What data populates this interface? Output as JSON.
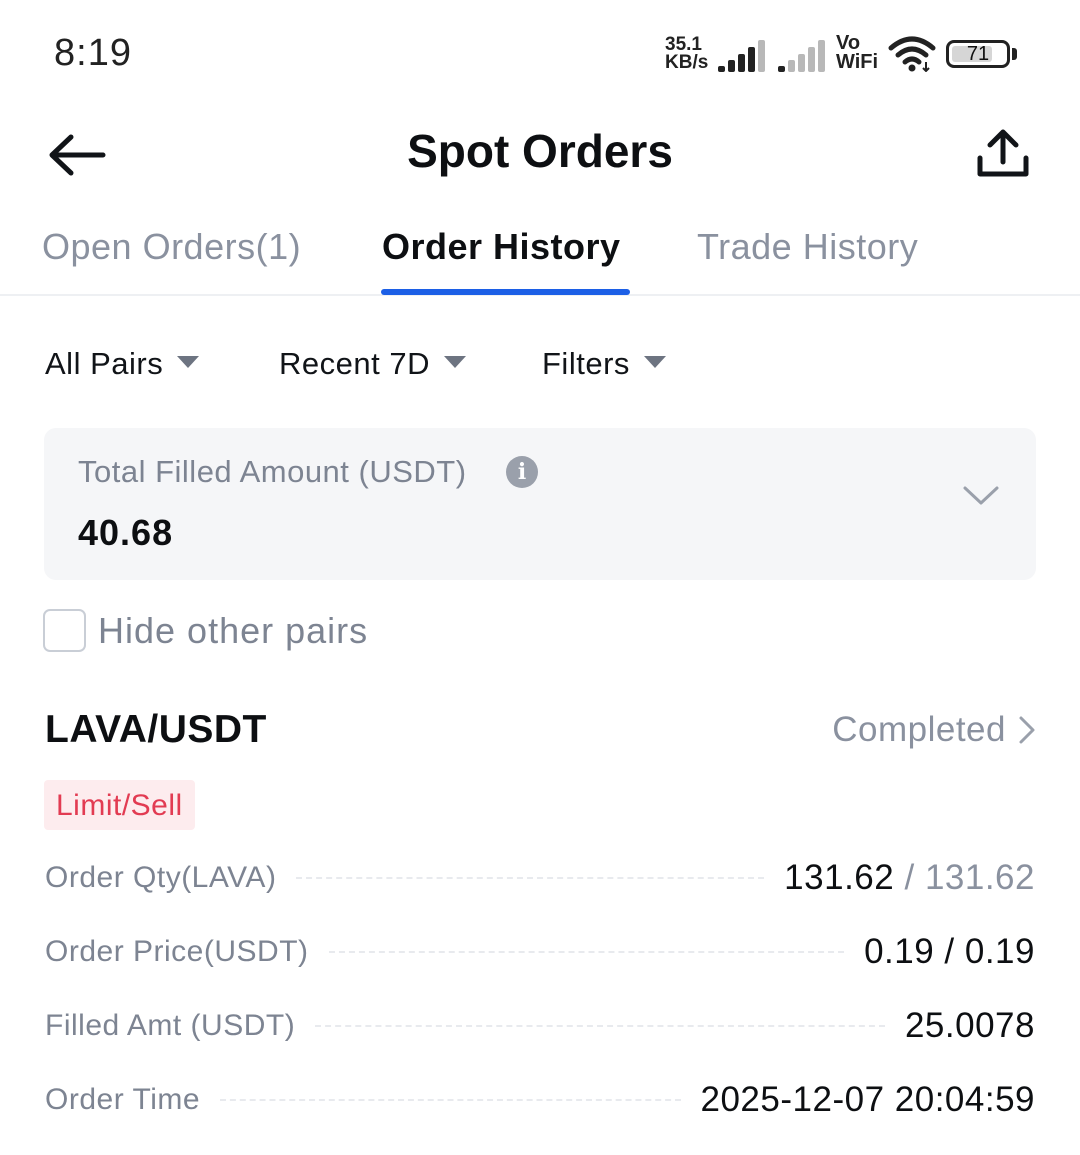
{
  "status_bar": {
    "time": "8:19",
    "net_speed_value": "35.1",
    "net_speed_unit": "KB/s",
    "vo_label": "Vo",
    "wifi_label": "WiFi",
    "battery_level": "71"
  },
  "header": {
    "title": "Spot Orders"
  },
  "tabs": [
    {
      "label": "Open Orders(1)",
      "active": false
    },
    {
      "label": "Order History",
      "active": true
    },
    {
      "label": "Trade History",
      "active": false
    }
  ],
  "filters": {
    "pairs": "All Pairs",
    "period": "Recent 7D",
    "filters": "Filters"
  },
  "summary": {
    "label": "Total Filled Amount (USDT)",
    "value": "40.68"
  },
  "hide_pairs": {
    "label": "Hide other pairs",
    "checked": false
  },
  "order": {
    "pair": "LAVA/USDT",
    "status": "Completed",
    "type": "Limit/Sell",
    "qty": {
      "label": "Order Qty(LAVA)",
      "filled": "131.62",
      "separator": "/",
      "total": "131.62"
    },
    "price": {
      "label": "Order Price(USDT)",
      "value": "0.19 / 0.19"
    },
    "filled_amt": {
      "label": "Filled Amt (USDT)",
      "value": "25.0078"
    },
    "time": {
      "label": "Order Time",
      "value": "2025-12-07 20:04:59"
    }
  },
  "colors": {
    "accent": "#1c5fe6",
    "sell": "#e23b52",
    "sell_bg": "#fdecee",
    "muted_text": "#7d8492"
  }
}
